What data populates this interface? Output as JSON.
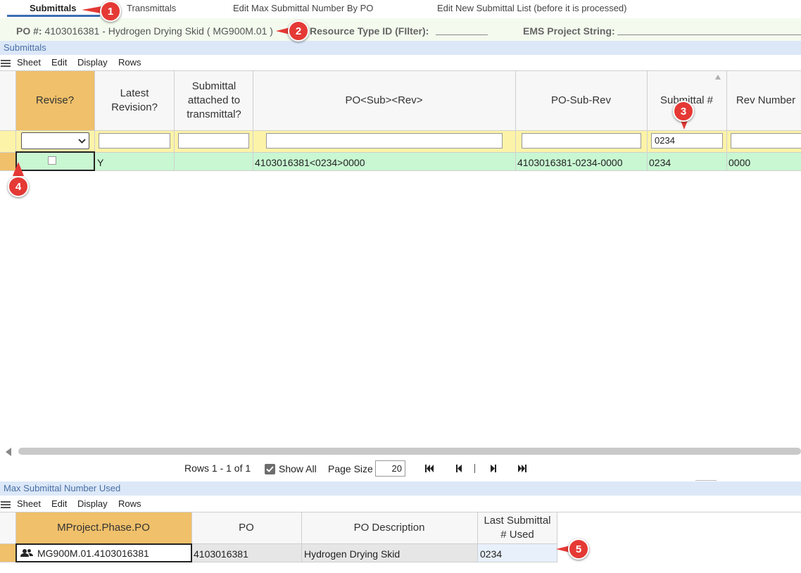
{
  "tabs": [
    {
      "label": "Submittals"
    },
    {
      "label": "Transmittals"
    },
    {
      "label": "Edit Max Submittal Number By PO"
    },
    {
      "label": "Edit New Submittal List (before it is processed)"
    }
  ],
  "info": {
    "po_label": "PO #:",
    "po_value": "4103016381 - Hydrogen Drying Skid ( MG900M.01 )",
    "resource_label": "Resource Type ID (FIlter):",
    "ems_label": "EMS Project String:"
  },
  "section1": {
    "title": "Submittals"
  },
  "menu": {
    "sheet": "Sheet",
    "edit": "Edit",
    "display": "Display",
    "rows": "Rows"
  },
  "grid": {
    "headers": {
      "revise": "Revise?",
      "latest": "Latest Revision?",
      "attached": "Submittal attached to transmittal?",
      "posubrev": "PO<Sub><Rev>",
      "po_sub_rev": "PO-Sub-Rev",
      "submittal": "Submittal #",
      "rev": "Rev Number"
    },
    "filter_submittal": "0234",
    "row": {
      "latest": "Y",
      "posubrev": "4103016381<0234>0000",
      "po_sub_rev": "4103016381-0234-0000",
      "submittal": "0234",
      "rev": "0000"
    }
  },
  "pager": {
    "rows_text": "Rows 1 - 1 of 1",
    "show_all": "Show All",
    "page_size_label": "Page Size",
    "page_size": "20"
  },
  "section2": {
    "title": "Max Submittal Number Used"
  },
  "grid2": {
    "headers": {
      "mproject": "MProject.Phase.PO",
      "po": "PO",
      "desc": "PO Description",
      "last": "Last Submittal # Used"
    },
    "row": {
      "mproject": "MG900M.01.4103016381",
      "po": "4103016381",
      "desc": "Hydrogen Drying Skid",
      "last": "0234"
    }
  },
  "badges": [
    "1",
    "2",
    "3",
    "4",
    "5"
  ],
  "colors": {
    "accent_header": "#f0c06a",
    "filter_row": "#fdf3a8",
    "data_row": "#c8f7d2",
    "section_bar": "#dce8f8",
    "badge": "#e53935"
  }
}
